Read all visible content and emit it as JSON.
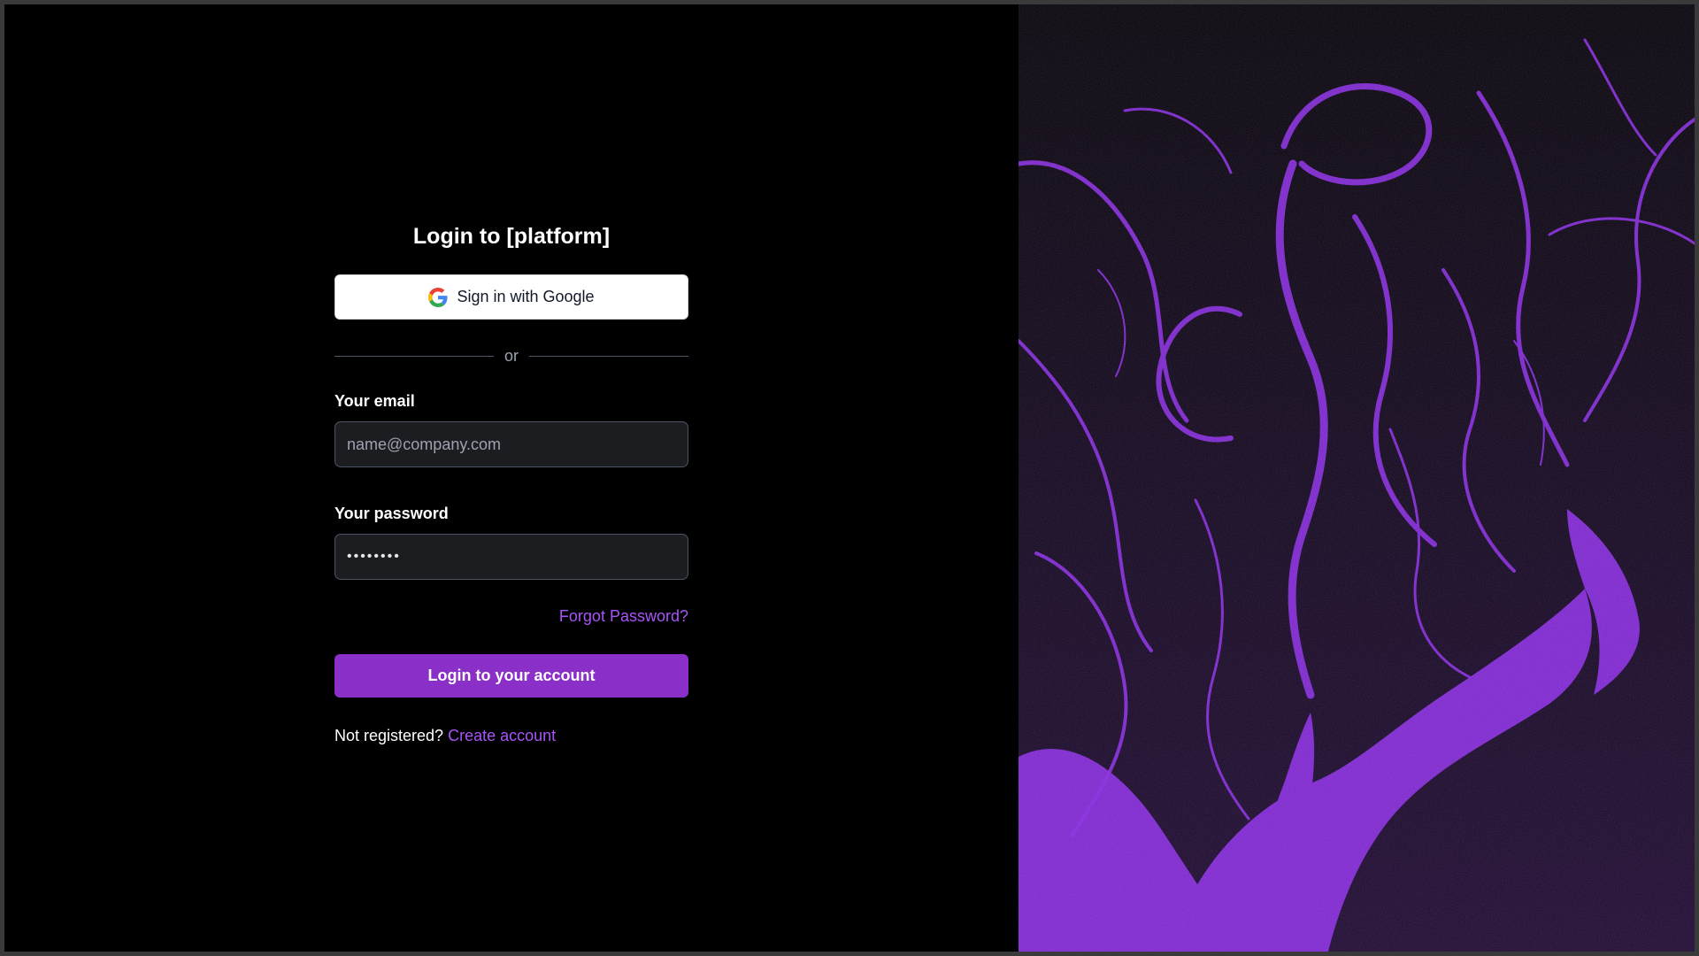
{
  "login": {
    "title": "Login to [platform]",
    "google_button_label": "Sign in with Google",
    "divider_text": "or",
    "email_label": "Your email",
    "email_placeholder": "name@company.com",
    "email_value": "",
    "password_label": "Your password",
    "password_value": "••••••••",
    "forgot_password_link": "Forgot Password?",
    "submit_button_label": "Login to your account",
    "register_prompt": "Not registered?",
    "register_link": "Create account"
  },
  "icons": {
    "google": "google-g-logo"
  },
  "colors": {
    "background": "#000000",
    "accent": "#8b2fc9",
    "link": "#a855f7",
    "input_background": "#1c1d21",
    "art_purple": "#8a2be2"
  }
}
